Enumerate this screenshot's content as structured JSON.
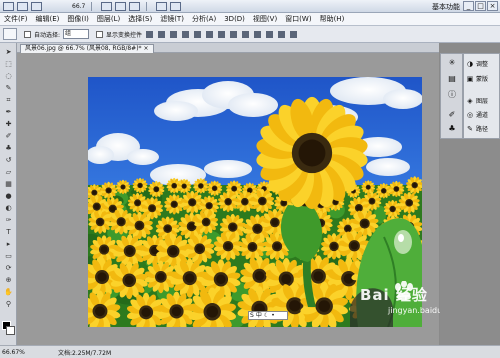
{
  "appbar": {
    "zoom": "66.7",
    "workspace": "基本功能",
    "minimize": "_",
    "restore": "□",
    "close": "×"
  },
  "menu": [
    "文件(F)",
    "编辑(E)",
    "图像(I)",
    "图层(L)",
    "选择(S)",
    "滤镜(T)",
    "分析(A)",
    "3D(D)",
    "视图(V)",
    "窗口(W)",
    "帮助(H)"
  ],
  "options": {
    "auto_select_label": "自动选择:",
    "auto_select_value": "组",
    "transform_label": "显示变换控件"
  },
  "document_tab": "风景06.jpg @ 66.7% (风景08, RGB/8#)*",
  "tab_close": "×",
  "panels": {
    "adjust": "调整",
    "mask": "蒙版",
    "layers": "图层",
    "channels": "通道",
    "paths": "路径"
  },
  "status": {
    "zoom": "66.67%",
    "doc": "文档:2.25M/7.72M"
  },
  "watermark": {
    "brand": "Bai  经验",
    "url": "jingyan.baidu.com"
  },
  "ime": {
    "icon": "S",
    "mode": "中"
  },
  "colors": {
    "sky": "#2f6fd8",
    "petal": "#f7c51a",
    "leaf": "#2f8f2a"
  }
}
